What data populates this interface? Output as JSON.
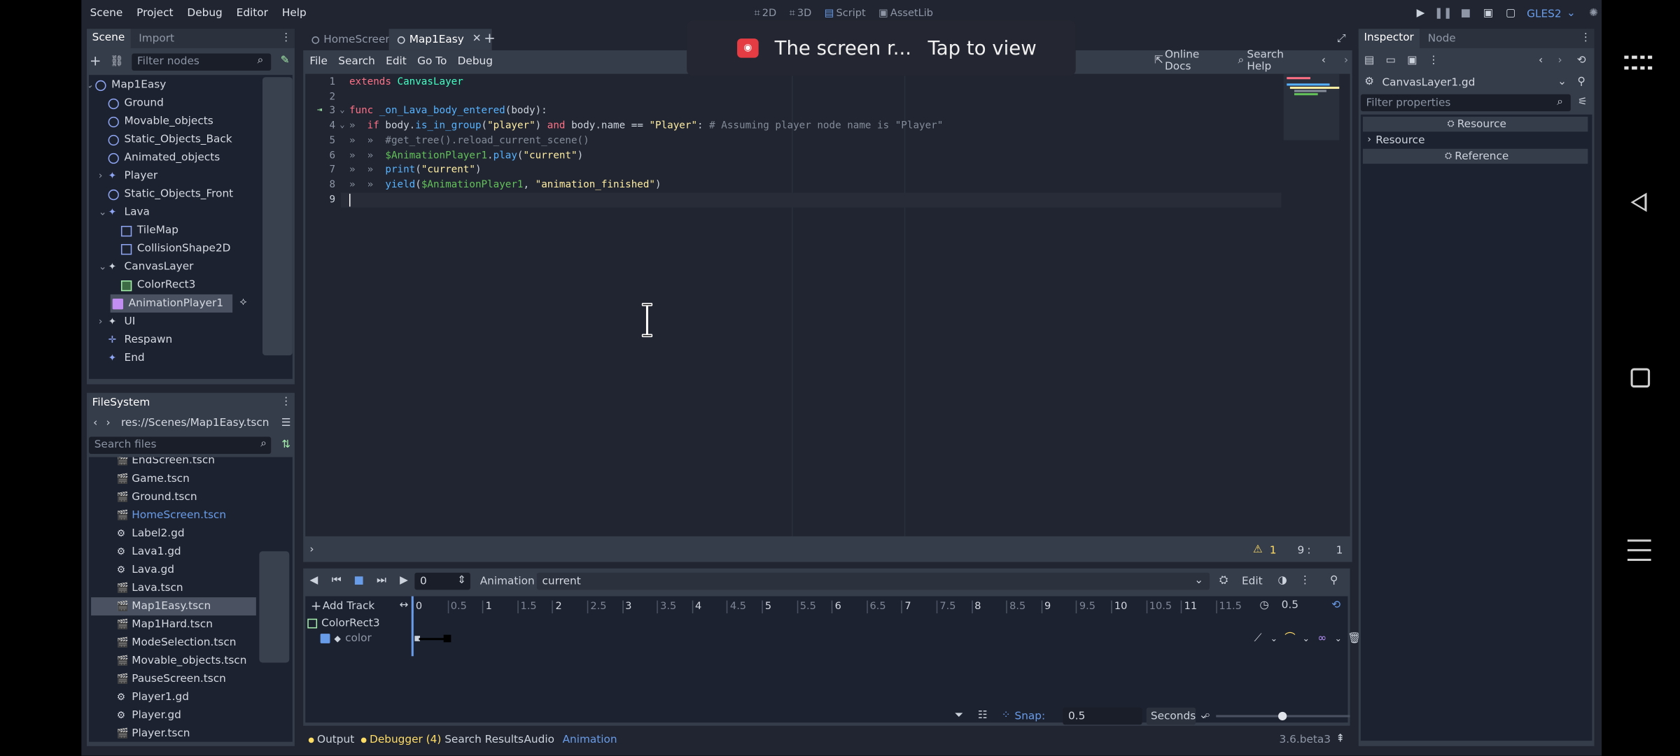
{
  "menu": {
    "scene": "Scene",
    "project": "Project",
    "debug": "Debug",
    "editor": "Editor",
    "help": "Help"
  },
  "workspace": {
    "two_d": "2D",
    "three_d": "3D",
    "script": "Script",
    "assetlib": "AssetLib"
  },
  "renderer": "GLES2",
  "scene_dock": {
    "tab_scene": "Scene",
    "tab_import": "Import",
    "filter_placeholder": "Filter nodes",
    "nodes": [
      {
        "label": "Map1Easy",
        "icon": "node2d-icon"
      },
      {
        "label": "Ground",
        "icon": "node2d-icon"
      },
      {
        "label": "Movable_objects",
        "icon": "node2d-icon"
      },
      {
        "label": "Static_Objects_Back",
        "icon": "node2d-icon"
      },
      {
        "label": "Animated_objects",
        "icon": "node2d-icon"
      },
      {
        "label": "Player",
        "icon": "kinematic-body-icon"
      },
      {
        "label": "Static_Objects_Front",
        "icon": "node2d-icon"
      },
      {
        "label": "Lava",
        "icon": "area2d-icon"
      },
      {
        "label": "TileMap",
        "icon": "tilemap-icon"
      },
      {
        "label": "CollisionShape2D",
        "icon": "collision-shape-icon"
      },
      {
        "label": "CanvasLayer",
        "icon": "canvas-layer-icon"
      },
      {
        "label": "ColorRect3",
        "icon": "color-rect-icon"
      },
      {
        "label": "AnimationPlayer1",
        "icon": "animation-player-icon"
      },
      {
        "label": "UI",
        "icon": "canvas-layer-icon"
      },
      {
        "label": "Respawn",
        "icon": "position2d-icon"
      },
      {
        "label": "End",
        "icon": "area2d-icon"
      }
    ]
  },
  "filesystem": {
    "title": "FileSystem",
    "path": "res://Scenes/Map1Easy.tscn",
    "search_placeholder": "Search files",
    "files": [
      "EndScreen.tscn",
      "Game.tscn",
      "Ground.tscn",
      "HomeScreen.tscn",
      "Label2.gd",
      "Lava1.gd",
      "Lava.gd",
      "Lava.tscn",
      "Map1Easy.tscn",
      "Map1Hard.tscn",
      "ModeSelection.tscn",
      "Movable_objects.tscn",
      "PauseScreen.tscn",
      "Player1.gd",
      "Player.gd",
      "Player.tscn"
    ]
  },
  "tabs": {
    "home": "HomeScreen",
    "map": "Map1Easy"
  },
  "script_menu": {
    "file": "File",
    "search": "Search",
    "edit": "Edit",
    "goto": "Go To",
    "debug": "Debug",
    "online_docs": "Online Docs",
    "search_help": "Search Help"
  },
  "code": {
    "numbers": [
      "1",
      "2",
      "3",
      "4",
      "5",
      "6",
      "7",
      "8",
      "9"
    ],
    "l1_kw": "extends",
    "l1_ty": "CanvasLayer",
    "l3_kw": "func",
    "l3_fn": "_on_Lava_body_entered",
    "l3_rest": "(body):",
    "l4_kw": "if",
    "l4_a": "body.",
    "l4_fn": "is_in_group",
    "l4_b": "(",
    "l4_s1": "\"player\"",
    "l4_c": ") ",
    "l4_and": "and",
    "l4_d": " body.name == ",
    "l4_s2": "\"Player\"",
    "l4_e": ": ",
    "l4_cm": "# Assuming player node name is \"Player\"",
    "l5_cm": "#get_tree().reload_current_scene()",
    "l6_np": "$AnimationPlayer1",
    "l6_a": ".",
    "l6_fn": "play",
    "l6_b": "(",
    "l6_s": "\"current\"",
    "l6_c": ")",
    "l7_fn": "print",
    "l7_a": "(",
    "l7_s": "\"current\"",
    "l7_b": ")",
    "l8_fn": "yield",
    "l8_a": "(",
    "l8_np": "$AnimationPlayer1",
    "l8_b": ", ",
    "l8_s": "\"animation_finished\"",
    "l8_c": ")"
  },
  "status": {
    "warnings": "1",
    "line": "9",
    "col": "1"
  },
  "toast": {
    "text": "The screen r...",
    "action": "Tap to view"
  },
  "animation": {
    "time": "0",
    "label": "Animation",
    "current": "current",
    "edit": "Edit",
    "add_track": "Add Track",
    "ticks": [
      "0",
      "0.5",
      "1",
      "1.5",
      "2",
      "2.5",
      "3",
      "3.5",
      "4",
      "4.5",
      "5",
      "5.5",
      "6",
      "6.5",
      "7",
      "7.5",
      "8",
      "8.5",
      "9",
      "9.5",
      "10",
      "10.5",
      "11",
      "11.5"
    ],
    "length": "0.5",
    "track_node": "ColorRect3",
    "track_prop": "color",
    "snap_label": "Snap:",
    "snap": "0.5",
    "unit": "Seconds"
  },
  "bottom": {
    "output": "Output",
    "debugger": "Debugger (4)",
    "search_results": "Search Results",
    "audio": "Audio",
    "animation": "Animation",
    "version": "3.6.beta3"
  },
  "inspector": {
    "tab_inspector": "Inspector",
    "tab_node": "Node",
    "resource_name": "CanvasLayer1.gd",
    "filter_placeholder": "Filter properties",
    "resource_header": "Resource",
    "resource_item": "Resource",
    "reference_header": "Reference"
  },
  "colors": {
    "accent": "#699ce8",
    "bg": "#202531",
    "panel": "#363d4a",
    "warning": "#ffdd65"
  }
}
